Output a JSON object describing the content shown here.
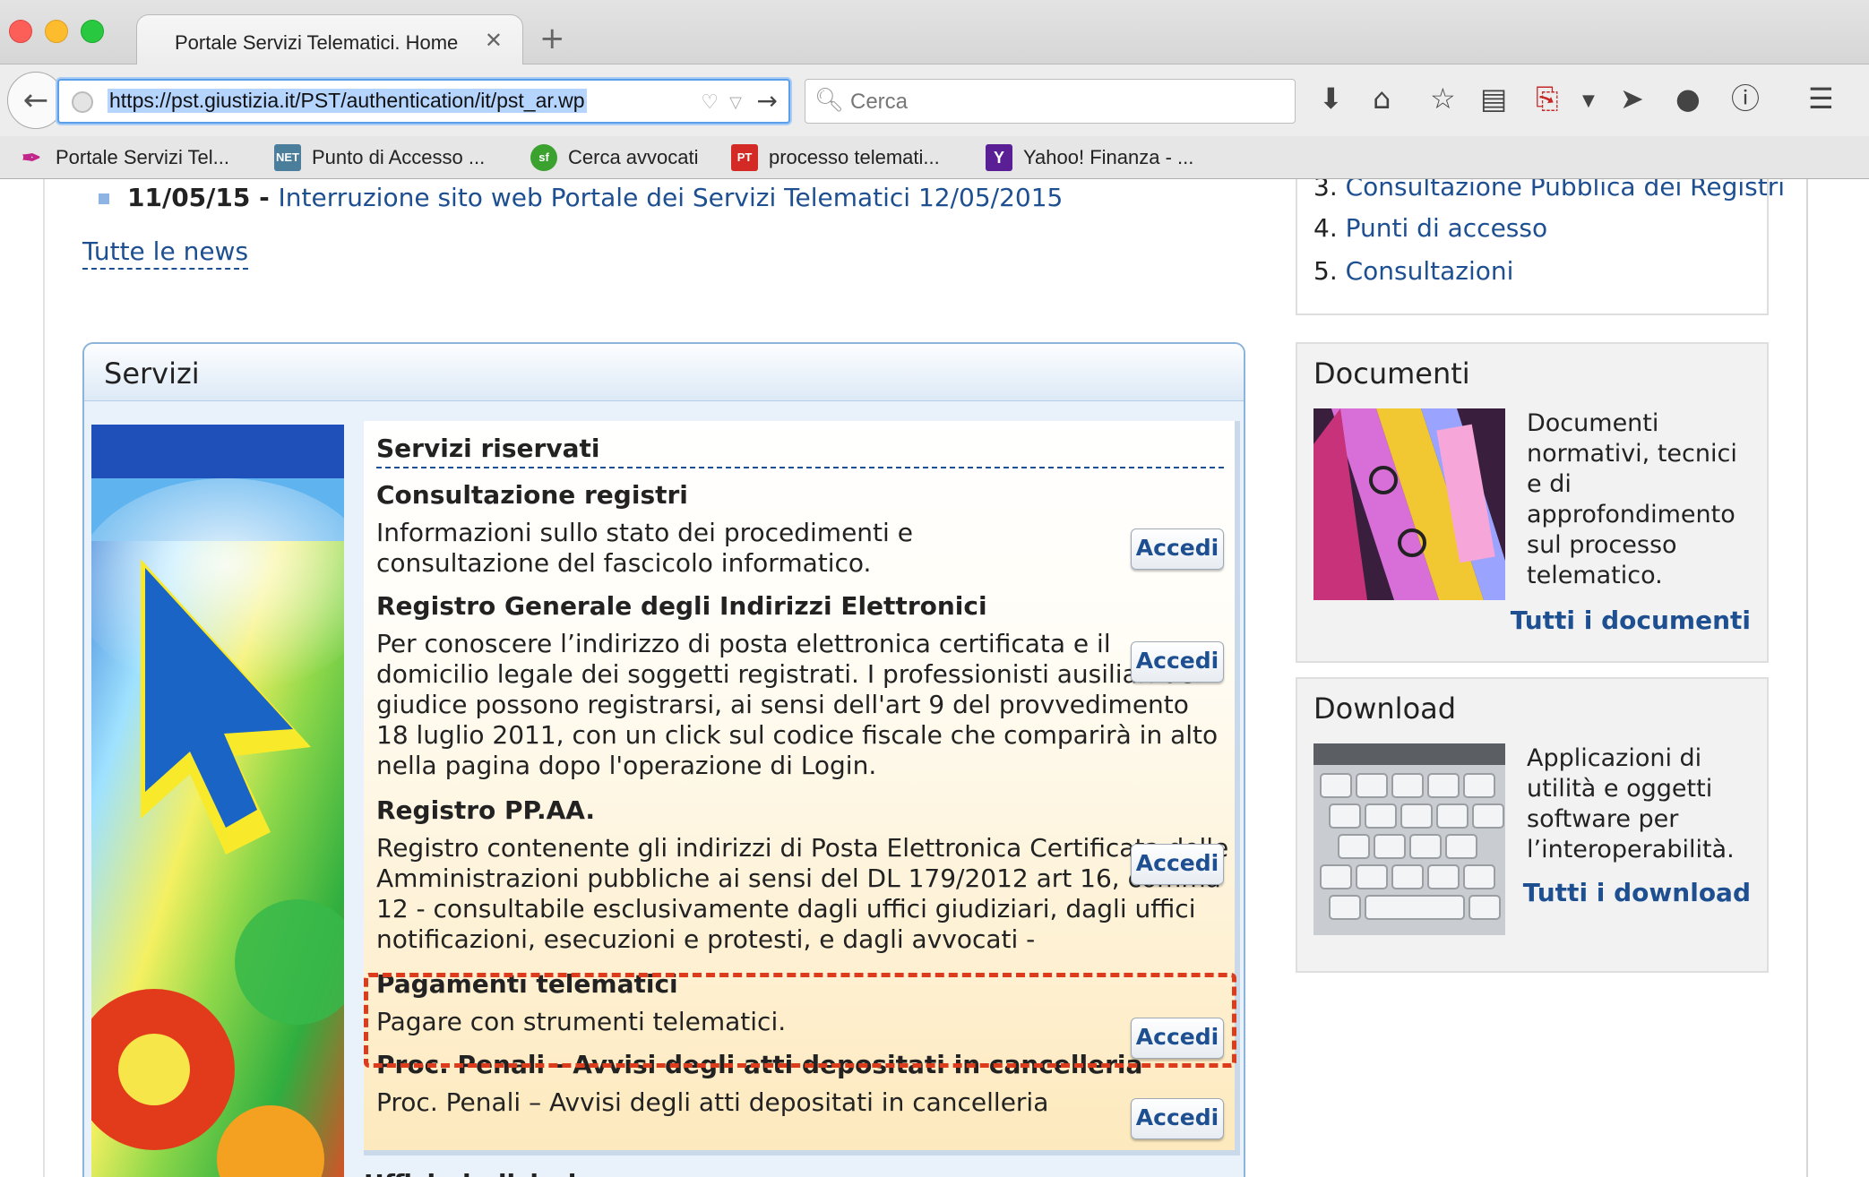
{
  "browser": {
    "tab_title": "Portale Servizi Telematici. Home",
    "tab_close": "✕",
    "new_tab": "+",
    "url": "https://pst.giustizia.it/PST/authentication/it/pst_ar.wp",
    "search_placeholder": "Cerca",
    "bookmarks": [
      {
        "label": "Portale Servizi Tel...",
        "icon": "quill-icon",
        "color": "#c1268a"
      },
      {
        "label": "Punto di Accesso ...",
        "icon": "net-icon",
        "color": "#4b7e9b"
      },
      {
        "label": "Cerca avvocati",
        "icon": "sf-icon",
        "color": "#3ba12f"
      },
      {
        "label": "processo telemati...",
        "icon": "pt-icon",
        "color": "#d42a25"
      },
      {
        "label": "Yahoo! Finanza - ...",
        "icon": "yahoo-icon",
        "color": "#5b1f95"
      }
    ],
    "bookmark_icon_text": [
      "",
      "NET",
      "sf",
      "PT",
      "Y"
    ]
  },
  "news": {
    "date": "11/05/15",
    "separator": " - ",
    "title": "Interruzione sito web Portale dei Servizi Telematici 12/05/2015",
    "all_news": "Tutte le news"
  },
  "right_list": {
    "items": [
      {
        "num": "3.",
        "label": "Consultazione Pubblica dei Registri"
      },
      {
        "num": "4.",
        "label": "Punti di accesso"
      },
      {
        "num": "5.",
        "label": "Consultazioni"
      }
    ]
  },
  "servizi": {
    "title": "Servizi",
    "section_title": "Servizi riservati",
    "button_label": "Accedi",
    "services": [
      {
        "name": "Consultazione registri",
        "desc": "Informazioni sullo stato dei procedimenti e consultazione del fascicolo informatico."
      },
      {
        "name": "Registro Generale degli Indirizzi Elettronici",
        "desc": "Per conoscere l’indirizzo di posta elettronica certificata e il domicilio legale dei soggetti registrati. I professionisti ausiliari del giudice possono registrarsi, ai sensi dell'art 9 del provvedimento 18 luglio 2011, con un click sul codice fiscale che comparirà in alto nella pagina dopo l'operazione di Login."
      },
      {
        "name": "Registro PP.AA.",
        "desc": "Registro contenente gli indirizzi di Posta Elettronica Certificata delle Amministrazioni pubbliche ai sensi del DL 179/2012 art 16, comma 12 - consultabile esclusivamente dagli uffici giudiziari, dagli uffici notificazioni, esecuzioni e protesti, e dagli avvocati -"
      },
      {
        "name": "Pagamenti telematici",
        "desc": "Pagare con strumenti telematici."
      },
      {
        "name": "Proc. Penali - Avvisi degli atti depositati in cancelleria",
        "desc": "Proc. Penali – Avvisi degli atti depositati in cancelleria"
      }
    ],
    "next_section": "Uffici giudiziari"
  },
  "documenti": {
    "title": "Documenti",
    "text": "Documenti normativi, tecnici e di approfondimento sul processo telematico.",
    "link": "Tutti i documenti"
  },
  "download": {
    "title": "Download",
    "text": "Applicazioni di utilità e oggetti software per l’interoperabilità.",
    "link": "Tutti i download"
  },
  "colors": {
    "link": "#1d4f91",
    "highlight": "#dc3b1c",
    "url_focus": "#5b9ee9"
  }
}
